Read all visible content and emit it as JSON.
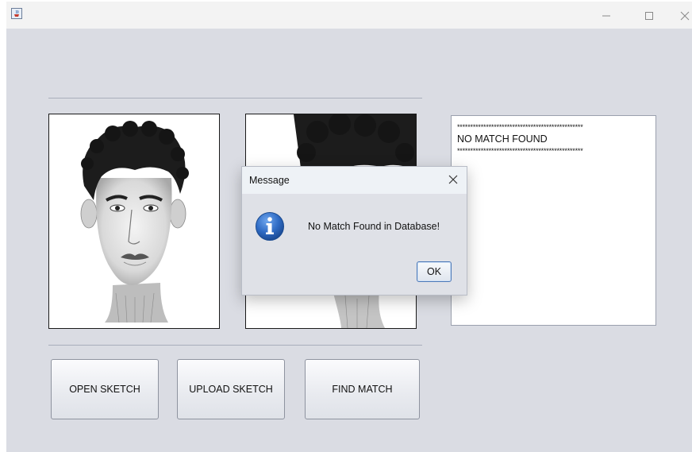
{
  "window": {
    "title": "",
    "icon": "java-cup-icon"
  },
  "main": {
    "sketch_image_left": "face-sketch",
    "sketch_image_middle": "face-sketch-partial",
    "result_panel": {
      "separator_top": "************************************************",
      "message": "NO MATCH FOUND",
      "separator_bottom": "************************************************"
    },
    "buttons": {
      "open_sketch": "OPEN SKETCH",
      "upload_sketch": "UPLOAD SKETCH",
      "find_match": "FIND MATCH"
    }
  },
  "dialog": {
    "title": "Message",
    "message": "No Match Found in Database!",
    "ok_label": "OK",
    "icon": "information-icon"
  }
}
